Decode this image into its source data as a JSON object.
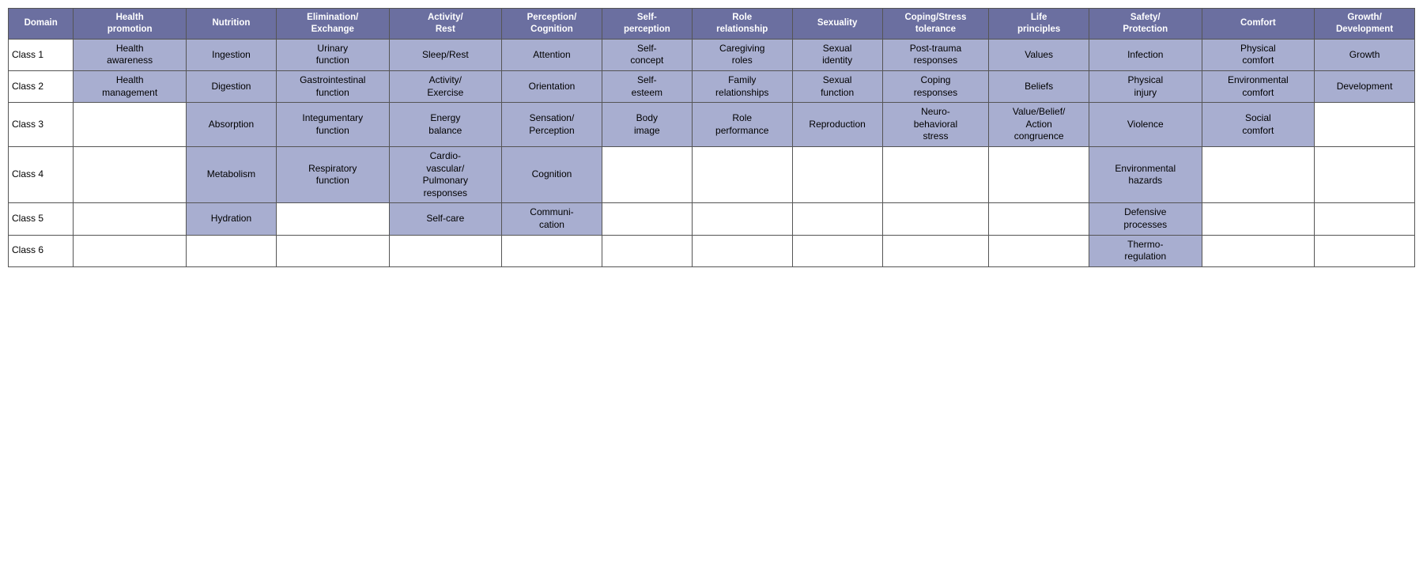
{
  "table": {
    "headers": {
      "domain": "Domain",
      "col1": {
        "line1": "Health",
        "line2": "promotion"
      },
      "col2": "Nutrition",
      "col3": {
        "line1": "Elimination/",
        "line2": "Exchange"
      },
      "col4": {
        "line1": "Activity/",
        "line2": "Rest"
      },
      "col5": {
        "line1": "Perception/",
        "line2": "Cognition"
      },
      "col6": {
        "line1": "Self-",
        "line2": "perception"
      },
      "col7": {
        "line1": "Role",
        "line2": "relationship"
      },
      "col8": "Sexuality",
      "col9": {
        "line1": "Coping/Stress",
        "line2": "tolerance"
      },
      "col10": {
        "line1": "Life",
        "line2": "principles"
      },
      "col11": {
        "line1": "Safety/",
        "line2": "Protection"
      },
      "col12": "Comfort",
      "col13": {
        "line1": "Growth/",
        "line2": "Development"
      }
    },
    "rows": [
      {
        "label": "Class 1",
        "cells": [
          {
            "text": "Health\nawareness",
            "filled": true
          },
          {
            "text": "Ingestion",
            "filled": true
          },
          {
            "text": "Urinary\nfunction",
            "filled": true
          },
          {
            "text": "Sleep/Rest",
            "filled": true
          },
          {
            "text": "Attention",
            "filled": true
          },
          {
            "text": "Self-\nconcept",
            "filled": true
          },
          {
            "text": "Caregiving\nroles",
            "filled": true
          },
          {
            "text": "Sexual\nidentity",
            "filled": true
          },
          {
            "text": "Post-trauma\nresponses",
            "filled": true
          },
          {
            "text": "Values",
            "filled": true
          },
          {
            "text": "Infection",
            "filled": true
          },
          {
            "text": "Physical\ncomfort",
            "filled": true
          },
          {
            "text": "Growth",
            "filled": true
          }
        ]
      },
      {
        "label": "Class 2",
        "cells": [
          {
            "text": "Health\nmanagement",
            "filled": true
          },
          {
            "text": "Digestion",
            "filled": true
          },
          {
            "text": "Gastrointestinal\nfunction",
            "filled": true
          },
          {
            "text": "Activity/\nExercise",
            "filled": true
          },
          {
            "text": "Orientation",
            "filled": true
          },
          {
            "text": "Self-\nesteem",
            "filled": true
          },
          {
            "text": "Family\nrelationships",
            "filled": true
          },
          {
            "text": "Sexual\nfunction",
            "filled": true
          },
          {
            "text": "Coping\nresponses",
            "filled": true
          },
          {
            "text": "Beliefs",
            "filled": true
          },
          {
            "text": "Physical\ninjury",
            "filled": true
          },
          {
            "text": "Environmental\ncomfort",
            "filled": true
          },
          {
            "text": "Development",
            "filled": true
          }
        ]
      },
      {
        "label": "Class 3",
        "cells": [
          {
            "text": "",
            "filled": false
          },
          {
            "text": "Absorption",
            "filled": true
          },
          {
            "text": "Integumentary\nfunction",
            "filled": true
          },
          {
            "text": "Energy\nbalance",
            "filled": true
          },
          {
            "text": "Sensation/\nPerception",
            "filled": true
          },
          {
            "text": "Body\nimage",
            "filled": true
          },
          {
            "text": "Role\nperformance",
            "filled": true
          },
          {
            "text": "Reproduction",
            "filled": true
          },
          {
            "text": "Neuro-\nbehavioral\nstress",
            "filled": true
          },
          {
            "text": "Value/Belief/\nAction\ncongruence",
            "filled": true
          },
          {
            "text": "Violence",
            "filled": true
          },
          {
            "text": "Social\ncomfort",
            "filled": true
          },
          {
            "text": "",
            "filled": false
          }
        ]
      },
      {
        "label": "Class 4",
        "cells": [
          {
            "text": "",
            "filled": false
          },
          {
            "text": "Metabolism",
            "filled": true
          },
          {
            "text": "Respiratory\nfunction",
            "filled": true
          },
          {
            "text": "Cardio-\nvascular/\nPulmonary\nresponses",
            "filled": true
          },
          {
            "text": "Cognition",
            "filled": true
          },
          {
            "text": "",
            "filled": false
          },
          {
            "text": "",
            "filled": false
          },
          {
            "text": "",
            "filled": false
          },
          {
            "text": "",
            "filled": false
          },
          {
            "text": "",
            "filled": false
          },
          {
            "text": "Environmental\nhazards",
            "filled": true
          },
          {
            "text": "",
            "filled": false
          },
          {
            "text": "",
            "filled": false
          }
        ]
      },
      {
        "label": "Class 5",
        "cells": [
          {
            "text": "",
            "filled": false
          },
          {
            "text": "Hydration",
            "filled": true
          },
          {
            "text": "",
            "filled": false
          },
          {
            "text": "Self-care",
            "filled": true
          },
          {
            "text": "Communi-\ncation",
            "filled": true
          },
          {
            "text": "",
            "filled": false
          },
          {
            "text": "",
            "filled": false
          },
          {
            "text": "",
            "filled": false
          },
          {
            "text": "",
            "filled": false
          },
          {
            "text": "",
            "filled": false
          },
          {
            "text": "Defensive\nprocesses",
            "filled": true
          },
          {
            "text": "",
            "filled": false
          },
          {
            "text": "",
            "filled": false
          }
        ]
      },
      {
        "label": "Class 6",
        "cells": [
          {
            "text": "",
            "filled": false
          },
          {
            "text": "",
            "filled": false
          },
          {
            "text": "",
            "filled": false
          },
          {
            "text": "",
            "filled": false
          },
          {
            "text": "",
            "filled": false
          },
          {
            "text": "",
            "filled": false
          },
          {
            "text": "",
            "filled": false
          },
          {
            "text": "",
            "filled": false
          },
          {
            "text": "",
            "filled": false
          },
          {
            "text": "",
            "filled": false
          },
          {
            "text": "Thermo-\nregulation",
            "filled": true
          },
          {
            "text": "",
            "filled": false
          },
          {
            "text": "",
            "filled": false
          }
        ]
      }
    ]
  }
}
